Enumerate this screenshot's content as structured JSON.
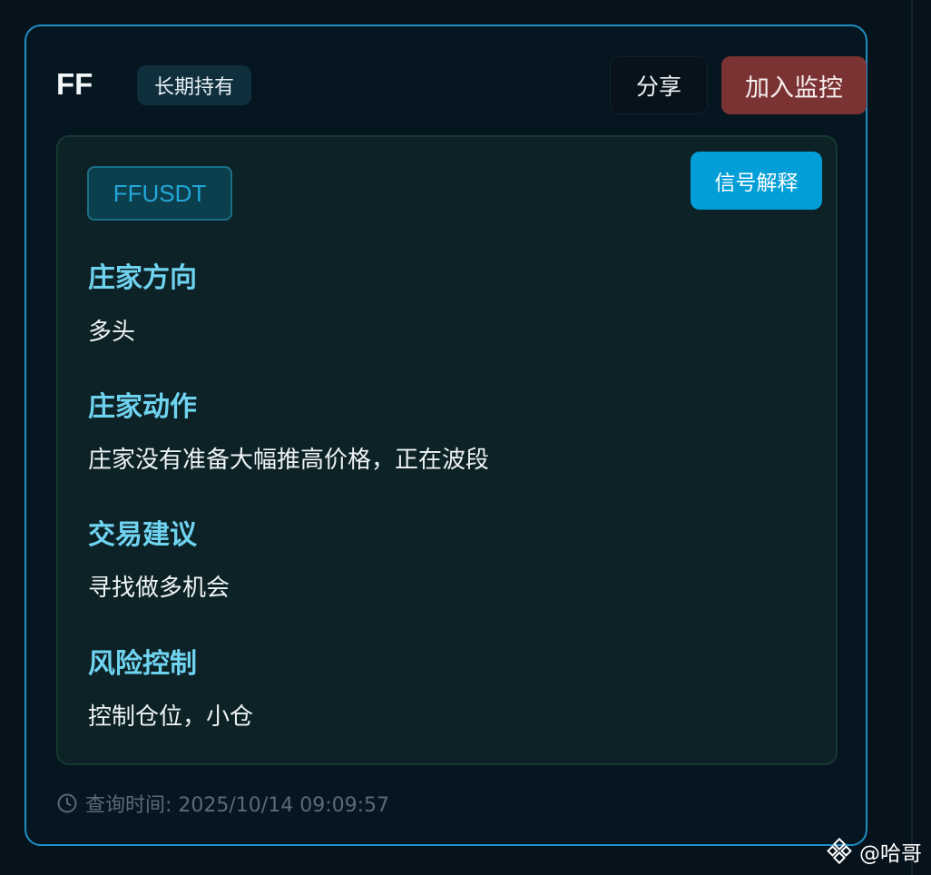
{
  "header": {
    "symbol": "FF",
    "tag": "长期持有",
    "share_label": "分享",
    "monitor_label": "加入监控"
  },
  "panel": {
    "pair": "FFUSDT",
    "explain_label": "信号解释",
    "sections": [
      {
        "title": "庄家方向",
        "text": "多头"
      },
      {
        "title": "庄家动作",
        "text": "庄家没有准备大幅推高价格，正在波段"
      },
      {
        "title": "交易建议",
        "text": "寻找做多机会"
      },
      {
        "title": "风险控制",
        "text": "控制仓位，小仓"
      }
    ]
  },
  "footer": {
    "query_time": "查询时间: 2025/10/14 09:09:57",
    "icon": "clock-icon"
  },
  "watermark": {
    "text": "@哈哥",
    "icon": "diamond-logo-icon"
  },
  "colors": {
    "accent_border": "#1f8fc4",
    "section_title": "#6fd3f0",
    "monitor_button": "#7a3232",
    "explain_button": "#029ed8"
  }
}
